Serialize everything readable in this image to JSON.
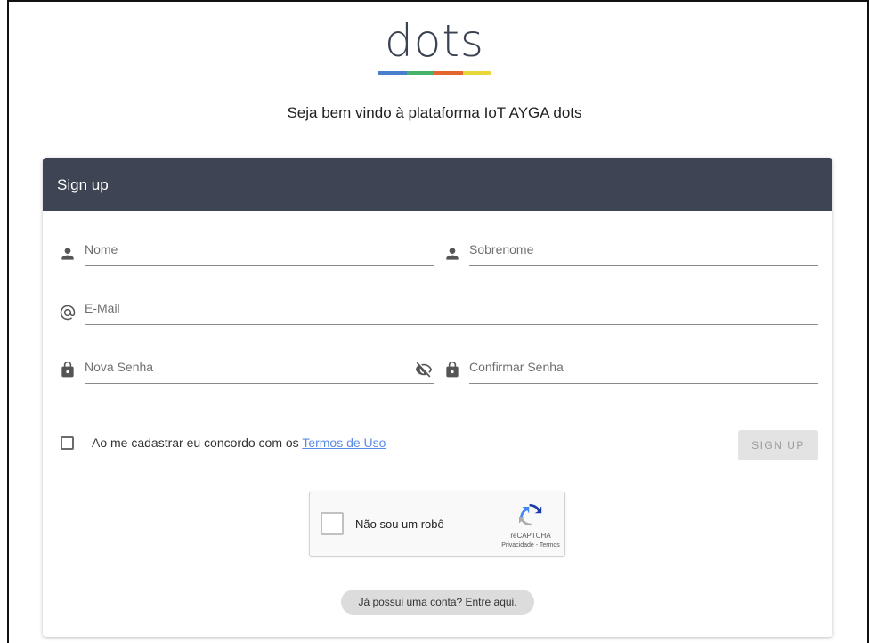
{
  "logo": {
    "text": "dots",
    "stripe_colors": [
      "#4a7fd0",
      "#47b26a",
      "#e5652e",
      "#e8d63a"
    ]
  },
  "welcome": "Seja bem vindo à plataforma IoT AYGA dots",
  "card": {
    "title": "Sign up",
    "header_color": "#3d4554"
  },
  "form": {
    "first_name": {
      "placeholder": "Nome",
      "value": "",
      "icon": "person-icon"
    },
    "last_name": {
      "placeholder": "Sobrenome",
      "value": "",
      "icon": "person-icon"
    },
    "email": {
      "placeholder": "E-Mail",
      "value": "",
      "icon": "at-icon"
    },
    "password": {
      "placeholder": "Nova Senha",
      "value": "",
      "icon": "lock-icon",
      "toggle_icon": "eye-off-icon"
    },
    "confirm_password": {
      "placeholder": "Confirmar Senha",
      "value": "",
      "icon": "lock-icon"
    }
  },
  "terms": {
    "text": "Ao me cadastrar eu concordo com os ",
    "link": "Termos de Uso",
    "checked": false
  },
  "signup_button": "SIGN UP",
  "recaptcha": {
    "label": "Não sou um robô",
    "brand": "reCAPTCHA",
    "links": "Privacidade - Termos"
  },
  "login_link": "Já possui uma conta? Entre aqui."
}
